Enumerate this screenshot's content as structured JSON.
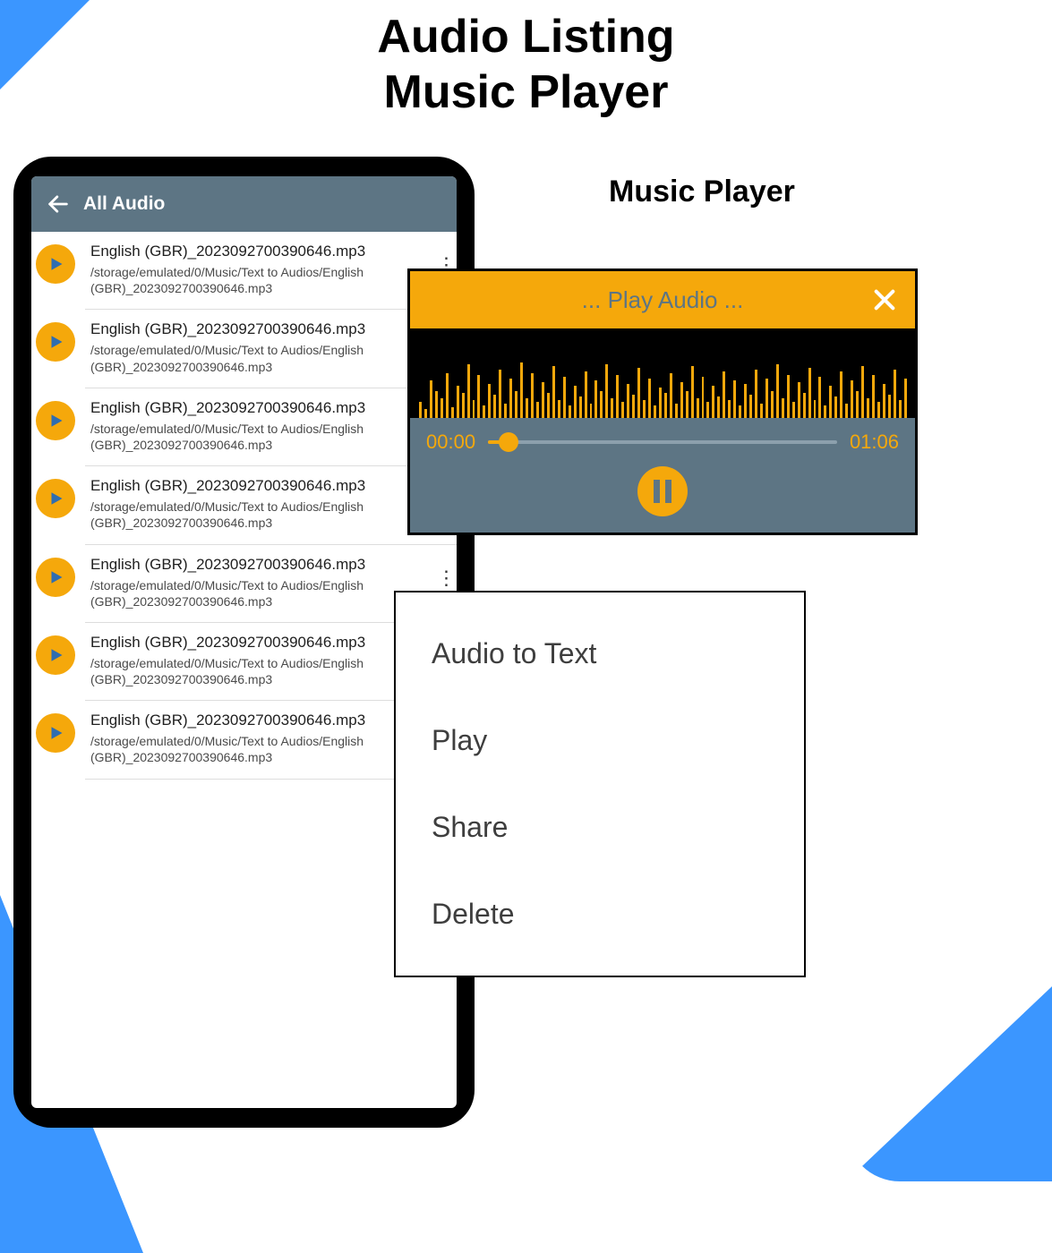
{
  "page": {
    "title_line1": "Audio Listing",
    "title_line2": "Music Player"
  },
  "label_music_player": "Music Player",
  "colors": {
    "accent": "#f5a80b",
    "header": "#5d7584",
    "blue": "#3b96ff"
  },
  "appbar": {
    "title": "All Audio"
  },
  "audio_items": [
    {
      "title": "English (GBR)_2023092700390646.mp3",
      "path": "/storage/emulated/0/Music/Text to Audios/English (GBR)_2023092700390646.mp3"
    },
    {
      "title": "English (GBR)_2023092700390646.mp3",
      "path": "/storage/emulated/0/Music/Text to Audios/English (GBR)_2023092700390646.mp3"
    },
    {
      "title": "English (GBR)_2023092700390646.mp3",
      "path": "/storage/emulated/0/Music/Text to Audios/English (GBR)_2023092700390646.mp3"
    },
    {
      "title": "English (GBR)_2023092700390646.mp3",
      "path": "/storage/emulated/0/Music/Text to Audios/English (GBR)_2023092700390646.mp3"
    },
    {
      "title": "English (GBR)_2023092700390646.mp3",
      "path": "/storage/emulated/0/Music/Text to Audios/English (GBR)_2023092700390646.mp3"
    },
    {
      "title": "English (GBR)_2023092700390646.mp3",
      "path": "/storage/emulated/0/Music/Text to Audios/English (GBR)_2023092700390646.mp3"
    },
    {
      "title": "English (GBR)_2023092700390646.mp3",
      "path": "/storage/emulated/0/Music/Text to Audios/English (GBR)_2023092700390646.mp3"
    }
  ],
  "player": {
    "title": "... Play Audio ...",
    "elapsed": "00:00",
    "duration": "01:06",
    "progress_pct": 6
  },
  "menu": {
    "items": [
      "Audio to Text",
      "Play",
      "Share",
      "Delete"
    ]
  }
}
